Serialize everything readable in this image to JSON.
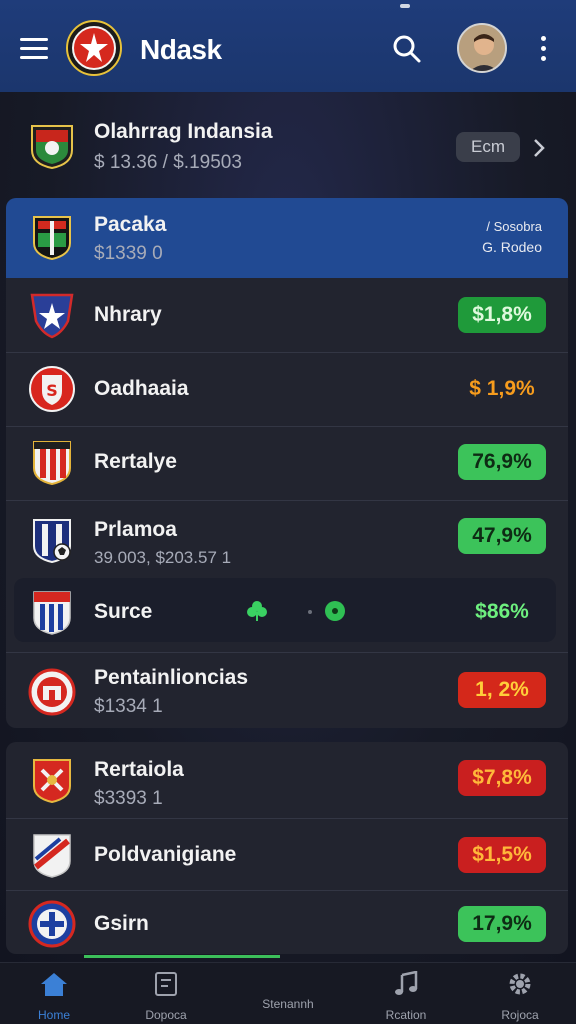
{
  "header": {
    "title": "Ndask",
    "icons": [
      "menu-icon",
      "search-icon",
      "more-icon"
    ]
  },
  "featured": {
    "name": "Olahrrag Indansia",
    "prices": "$ 13.36 /  $.19503",
    "badge": "Ecm"
  },
  "selected": {
    "name": "Pacaka",
    "sub": "$1339 0",
    "right_line1": "Sosobra",
    "right_line2": "G. Rodeo"
  },
  "rows": [
    {
      "name": "Nhrary",
      "badge": "$1,8%"
    },
    {
      "name": "Oadhaaia",
      "badge": "$ 1,9%"
    },
    {
      "name": "Rertalye",
      "badge": "76,9%"
    },
    {
      "name": "Prlamoa",
      "sub": "39.003, $203.57 1",
      "badge": "47,9%"
    },
    {
      "name": "Surce",
      "badge": "$86%"
    },
    {
      "name": "Pentainlioncias",
      "sub": "$1334 1",
      "badge": "1, 2%"
    }
  ],
  "rows2": [
    {
      "name": "Rertaiola",
      "sub": "$3393 1",
      "badge": "$7,8%"
    },
    {
      "name": "Poldvanigiane",
      "badge": "$1,5%"
    },
    {
      "name": "Gsirn",
      "badge": "17,9%"
    }
  ],
  "nav": [
    {
      "label": "Home"
    },
    {
      "label": "Dopoca"
    },
    {
      "label": "Stenannh"
    },
    {
      "label": "Rcation"
    },
    {
      "label": "Rojoca"
    }
  ],
  "colors": {
    "header": "#1f3c7a",
    "accent": "#3b80d6",
    "up": "#3cc35a",
    "down": "#d4281a"
  }
}
